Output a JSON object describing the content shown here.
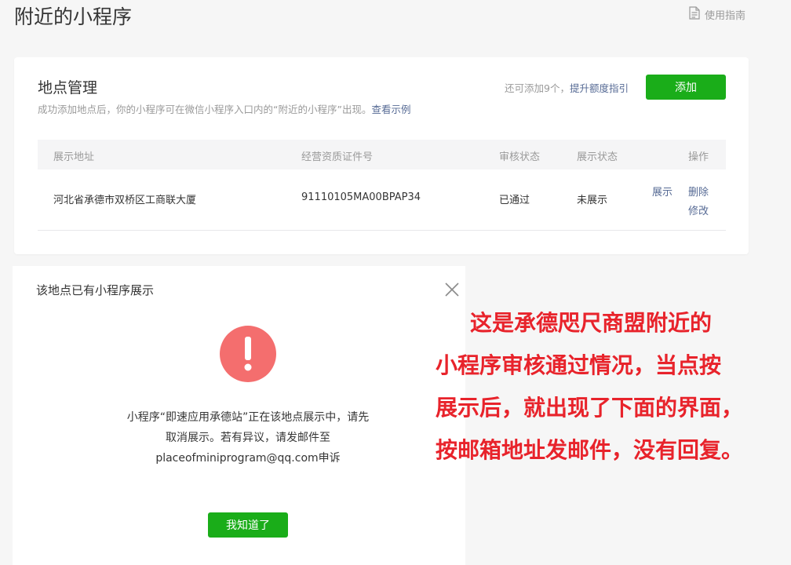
{
  "header": {
    "page_title": "附近的小程序",
    "guide_label": "使用指南",
    "guide_icon": "document-icon"
  },
  "location_card": {
    "title": "地点管理",
    "description": "成功添加地点后，你的小程序可在微信小程序入口内的“附近的小程序”出现。",
    "example_link": "查看示例",
    "quota_text": "还可添加9个，",
    "quota_link": "提升额度指引",
    "add_button": "添加",
    "table": {
      "columns": [
        "展示地址",
        "经营资质证件号",
        "审核状态",
        "展示状态",
        "操作"
      ],
      "rows": [
        {
          "address": "河北省承德市双桥区工商联大厦",
          "license": "91110105MA00BPAP34",
          "review_status": "已通过",
          "display_status": "未展示",
          "actions": {
            "show": "展示",
            "delete": "删除",
            "edit": "修改"
          }
        }
      ]
    }
  },
  "dialog": {
    "title": "该地点已有小程序展示",
    "close_icon": "close-icon",
    "alert_icon": "exclamation-circle-icon",
    "message_lines": [
      "小程序“即速应用承德站”正在该地点展示中，请先",
      "取消展示。若有异议，请发邮件至",
      "placeofminiprogram@qq.com申诉"
    ],
    "confirm_button": "我知道了"
  },
  "annotation": {
    "lines": [
      "这是承德咫尺商盟附近的",
      "小程序审核通过情况，当点按",
      "展示后，就出现了下面的界面，",
      "按邮箱地址发邮件，没有回复。"
    ]
  },
  "colors": {
    "primary_green": "#1aad19",
    "link_blue": "#576b95",
    "alert_red": "#f46e6e",
    "annotation_red": "#e8232b"
  }
}
